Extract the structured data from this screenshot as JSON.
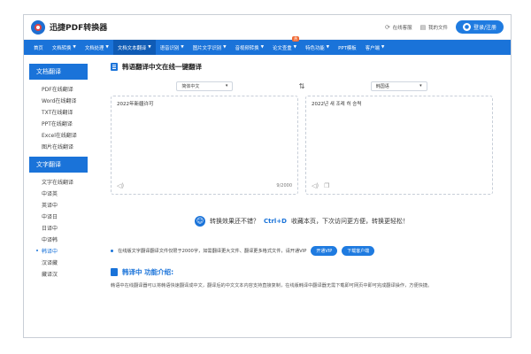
{
  "header": {
    "logo_text": "迅捷PDF转换器",
    "links": [
      {
        "icon": "⟳",
        "label": "在线客服"
      },
      {
        "icon": "▤",
        "label": "我的文件"
      }
    ],
    "login_label": "登录/注册"
  },
  "nav": {
    "items": [
      {
        "label": "首页",
        "caret": ""
      },
      {
        "label": "文档转换",
        "caret": "▼"
      },
      {
        "label": "文档处理",
        "caret": "▼"
      },
      {
        "label": "文档文本翻译",
        "caret": "▼"
      },
      {
        "label": "语音识别",
        "caret": "▼"
      },
      {
        "label": "图片文字识别",
        "caret": "▼"
      },
      {
        "label": "音视频转换",
        "caret": "▼"
      },
      {
        "label": "论文查重",
        "caret": "▼",
        "badge": "热"
      },
      {
        "label": "特色功能",
        "caret": "▼"
      },
      {
        "label": "PPT模板",
        "caret": ""
      },
      {
        "label": "客户端",
        "caret": "▼"
      }
    ]
  },
  "sidebar": {
    "doc_heading": "文档翻译",
    "doc_items": [
      "PDF在线翻译",
      "Word在线翻译",
      "TXT在线翻译",
      "PPT在线翻译",
      "Excel在线翻译",
      "图片在线翻译"
    ],
    "text_heading": "文字翻译",
    "text_items": [
      "文字在线翻译",
      "中译英",
      "英译中",
      "中译日",
      "日译中",
      "中译韩",
      "韩译中",
      "汉译藏",
      "藏译汉"
    ]
  },
  "main": {
    "title": "韩语翻译中文在线一键翻译",
    "source_lang": "简体中文",
    "target_lang": "韩国语",
    "swap_icon": "⇅",
    "source_text": "2022年新疆许可",
    "target_text": "2022년 새 조례 허 승력",
    "char_count": "9/2000",
    "promo": {
      "before": "转换效果还不错？",
      "highlight": "Ctrl+D",
      "after": "收藏本页，下次访问更方便，转换更轻松！"
    },
    "tip": {
      "text": "在线版文字翻译翻译文件仅限于2000字，如需翻译更大文件、翻译更多格式文件，请开通VIP",
      "vip_button": "开通VIP",
      "download_button": "下载客户端"
    },
    "intro_title": "韩译中 功能介绍:",
    "intro_text": "韩语中在线翻译器可以将韩语快速翻译成中文，翻译后的中文文本内容支持直接复制，在线版韩译中翻译器无需下载即可网页中即可完成翻译操作，方便快捷。"
  },
  "colors": {
    "accent": "#1a73d9",
    "hot_badge": "#f06a35"
  }
}
